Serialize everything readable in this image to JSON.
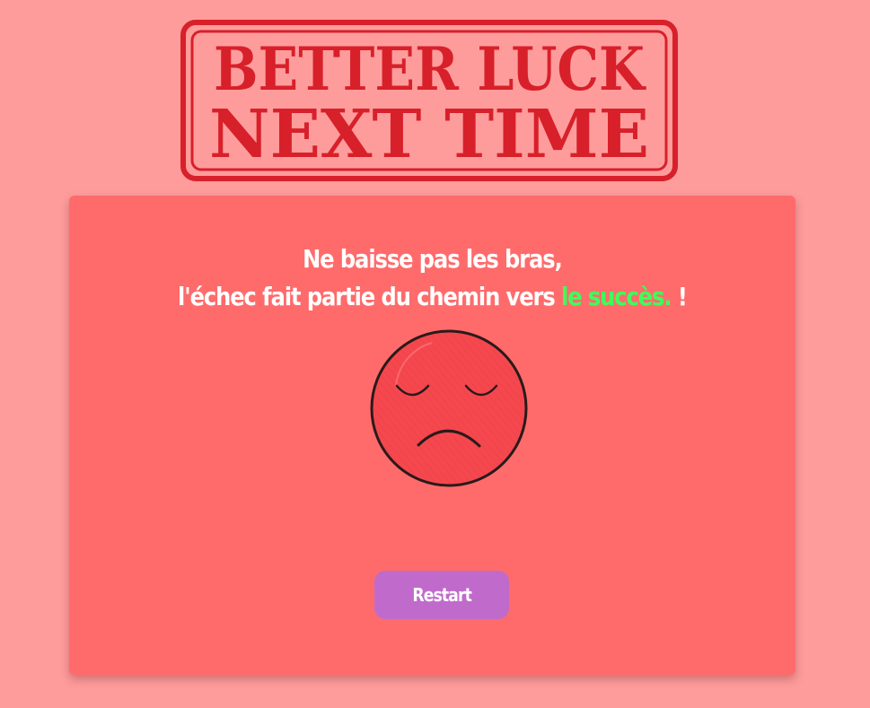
{
  "logo": {
    "line1": "BETTER LUCK",
    "line2": "NEXT TIME",
    "color": "#d8202a"
  },
  "card": {
    "message_line1": "Ne baisse pas les bras,",
    "message_line2_start": "l'échec fait partie du chemin vers ",
    "message_highlight": "le succès.",
    "message_end": " !",
    "highlight_color": "#3cff5a",
    "face_icon": "sad-face-icon",
    "restart_label": "Restart"
  },
  "colors": {
    "background": "#fe9c9c",
    "card": "#ff6b6b",
    "button": "#c06bcb",
    "face": "#f4484e"
  }
}
